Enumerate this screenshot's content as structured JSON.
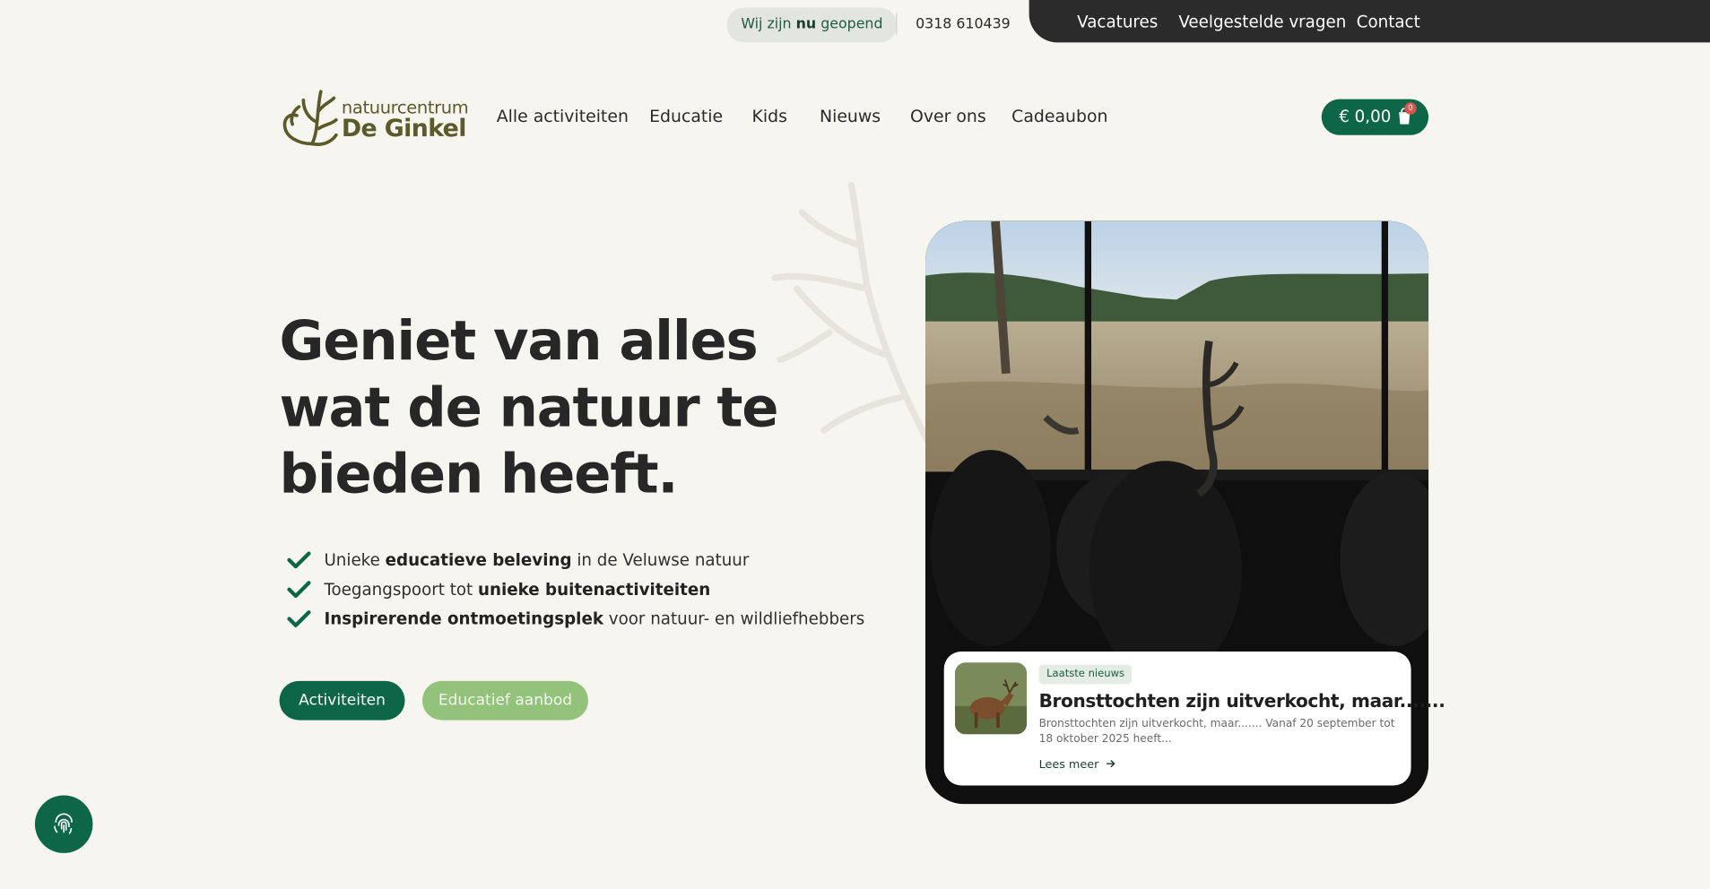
{
  "topbar": {
    "open_prefix": "Wij zijn",
    "open_bold": "nu",
    "open_suffix": "geopend",
    "phone": "0318 610439",
    "links": [
      "Vacatures",
      "Veelgestelde vragen",
      "Contact"
    ]
  },
  "logo": {
    "small": "natuurcentrum",
    "big": "De Ginkel"
  },
  "nav": [
    "Alle activiteiten",
    "Educatie",
    "Kids",
    "Nieuws",
    "Over ons",
    "Cadeaubon"
  ],
  "cart": {
    "price": "€ 0,00",
    "count": "0"
  },
  "hero": {
    "title": "Geniet van alles wat de natuur te bieden heeft.",
    "bullets": [
      {
        "pre": "Unieke ",
        "bold": "educatieve beleving",
        "post": " in de Veluwse natuur"
      },
      {
        "pre": "Toegangspoort tot ",
        "bold": "unieke buitenactiviteiten",
        "post": ""
      },
      {
        "pre": "",
        "bold": "Inspirerende ontmoetingsplek",
        "post": " voor natuur- en wildliefhebbers"
      }
    ],
    "btn_primary": "Activiteiten",
    "btn_secondary": "Educatief aanbod"
  },
  "news": {
    "tag": "Laatste nieuws",
    "title": "Bronsttochten zijn uitverkocht, maar.......",
    "excerpt": "Bronsttochten zijn uitverkocht, maar....... Vanaf 20 september tot 18 oktober 2025 heeft...",
    "more": "Lees meer"
  },
  "colors": {
    "primary": "#0e6648",
    "secondary": "#93c27a",
    "dark": "#2b2b2b",
    "background": "#f6f5f0",
    "logo": "#5c5a2a"
  },
  "icons": {
    "fingerprint": "fingerprint-icon",
    "cart": "cart-icon",
    "check": "check-icon",
    "arrow": "arrow-right-icon"
  }
}
